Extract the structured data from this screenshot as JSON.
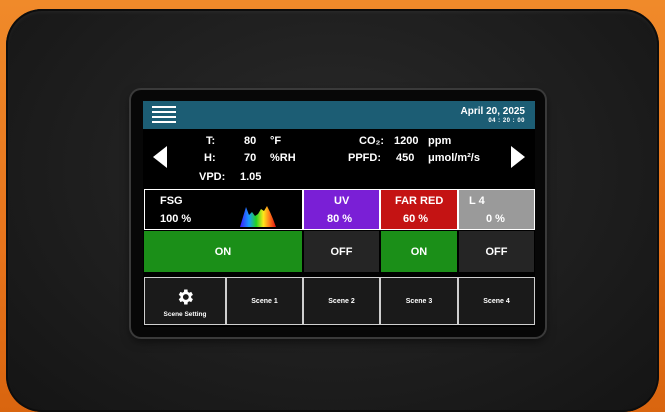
{
  "header": {
    "date": "April 20, 2025",
    "time": "04 : 20 : 00"
  },
  "readings": {
    "temperature": {
      "label": "T:",
      "value": "80",
      "unit": "°F"
    },
    "humidity": {
      "label": "H:",
      "value": "70",
      "unit": "%RH"
    },
    "vpd": {
      "label": "VPD:",
      "value": "1.05"
    },
    "co2": {
      "label": "CO₂:",
      "value": "1200",
      "unit": "ppm"
    },
    "ppfd": {
      "label": "PPFD:",
      "value": "450",
      "unit": "μmol/m²/s"
    }
  },
  "channels": [
    {
      "name": "FSG",
      "percent": "100 %",
      "color": "#000000",
      "state": "ON"
    },
    {
      "name": "UV",
      "percent": "80  %",
      "color": "#7a1fd6",
      "state": "OFF"
    },
    {
      "name": "FAR RED",
      "percent": "60  %",
      "color": "#c41313",
      "state": "ON"
    },
    {
      "name": "L 4",
      "percent": "0  %",
      "color": "#9a9a9a",
      "state": "OFF"
    }
  ],
  "scenes": {
    "setting_label": "Scene Setting",
    "items": [
      "Scene 1",
      "Scene 2",
      "Scene 3",
      "Scene 4"
    ]
  },
  "icons": [
    "menu-icon",
    "arrow-left-icon",
    "arrow-right-icon",
    "spectrum-icon",
    "gear-icon"
  ]
}
